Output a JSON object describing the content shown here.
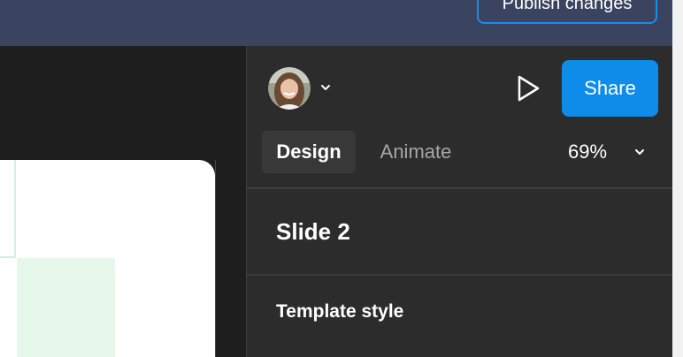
{
  "header": {
    "publish_label": "Publish changes"
  },
  "toolbar": {
    "avatar_icon": "user-avatar",
    "avatar_menu_icon": "chevron-down-icon",
    "present_icon": "play-icon",
    "share_label": "Share"
  },
  "tabs": {
    "design_label": "Design",
    "animate_label": "Animate",
    "active": "Design"
  },
  "zoom": {
    "value": "69%",
    "icon": "chevron-down-icon"
  },
  "properties": {
    "slide_title": "Slide 2",
    "template_style_label": "Template style"
  },
  "colors": {
    "accent": "#0d8ce9",
    "topbar": "#3a4461",
    "panel": "#2c2c2c",
    "canvas": "#1e1e1e",
    "slide_green": "#e6f7ec"
  }
}
